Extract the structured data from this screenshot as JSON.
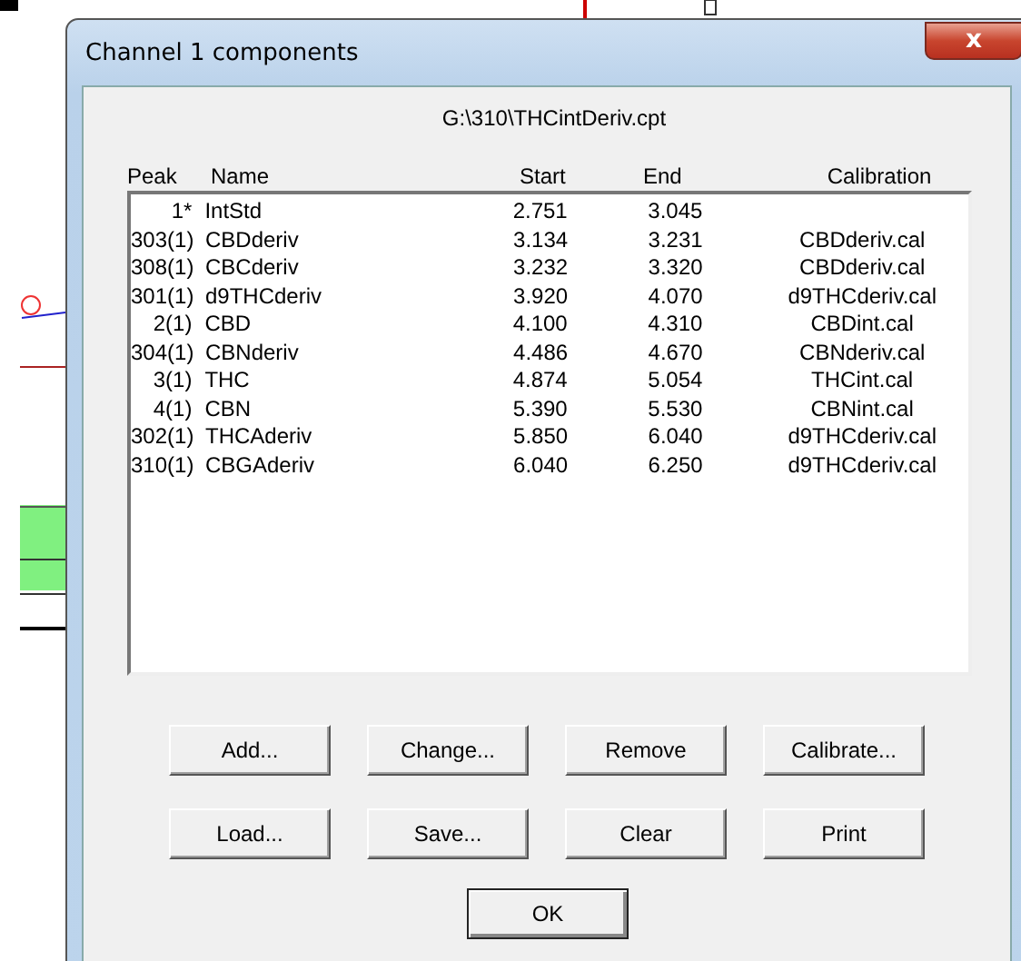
{
  "window": {
    "title": "Channel 1 components",
    "close": "x"
  },
  "file_path": "G:\\310\\THCintDeriv.cpt",
  "table": {
    "columns": [
      "Peak",
      "Name",
      "Start",
      "End",
      "Calibration"
    ],
    "rows": [
      [
        "1*",
        "IntStd",
        "2.751",
        "3.045",
        ""
      ],
      [
        "303(1)",
        "CBDderiv",
        "3.134",
        "3.231",
        "CBDderiv.cal"
      ],
      [
        "308(1)",
        "CBCderiv",
        "3.232",
        "3.320",
        "CBDderiv.cal"
      ],
      [
        "301(1)",
        "d9THCderiv",
        "3.920",
        "4.070",
        "d9THCderiv.cal"
      ],
      [
        "2(1)",
        "CBD",
        "4.100",
        "4.310",
        "CBDint.cal"
      ],
      [
        "304(1)",
        "CBNderiv",
        "4.486",
        "4.670",
        "CBNderiv.cal"
      ],
      [
        "3(1)",
        "THC",
        "4.874",
        "5.054",
        "THCint.cal"
      ],
      [
        "4(1)",
        "CBN",
        "5.390",
        "5.530",
        "CBNint.cal"
      ],
      [
        "302(1)",
        "THCAderiv",
        "5.850",
        "6.040",
        "d9THCderiv.cal"
      ],
      [
        "310(1)",
        "CBGAderiv",
        "6.040",
        "6.250",
        "d9THCderiv.cal"
      ]
    ]
  },
  "buttons": [
    [
      "Add...",
      "Change...",
      "Remove",
      "Calibrate..."
    ],
    [
      "Load...",
      "Save...",
      "Clear",
      "Print"
    ]
  ],
  "ok_button": "OK"
}
